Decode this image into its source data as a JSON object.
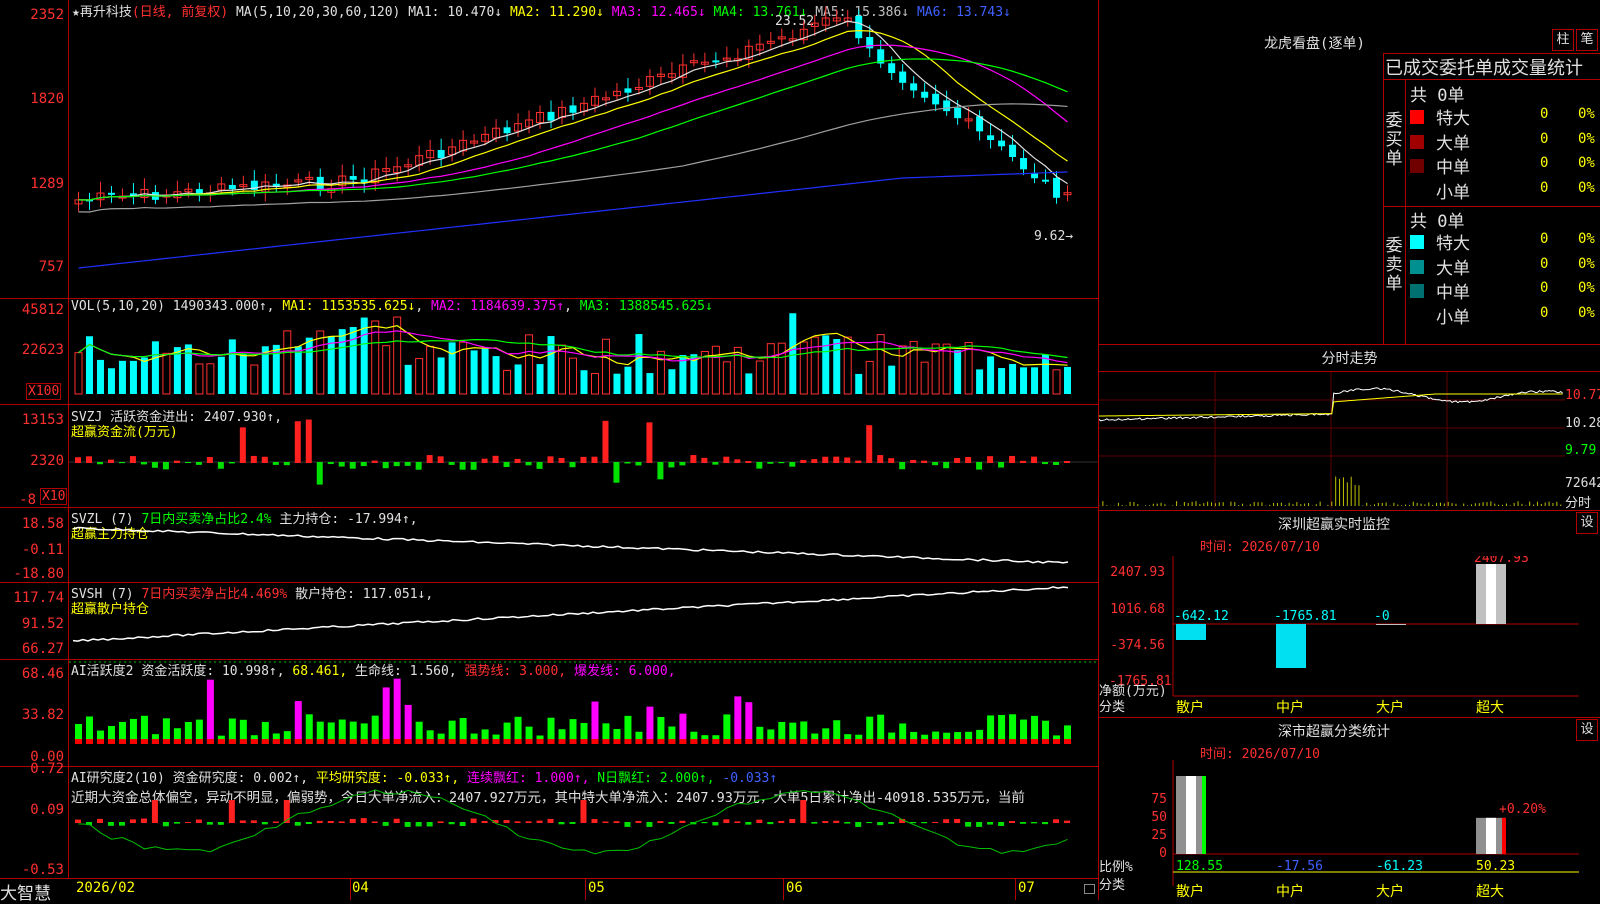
{
  "main": {
    "stock_name": "再升科技",
    "period": "(日线, 前复权)",
    "ma_params": "MA(5,10,20,30,60,120)",
    "ma_values": [
      {
        "label": "MA1: 10.470↓",
        "color": "#e0e0e0"
      },
      {
        "label": "MA2: 11.290↓",
        "color": "#ffff00"
      },
      {
        "label": "MA3: 12.465↓",
        "color": "#ff00ff"
      },
      {
        "label": "MA4: 13.761↓",
        "color": "#00ff00"
      },
      {
        "label": "MA5: 15.386↓",
        "color": "#c0c0c0"
      },
      {
        "label": "MA6: 13.743↓",
        "color": "#4060ff"
      }
    ],
    "y_ticks": [
      "2352",
      "1820",
      "1289",
      "757"
    ],
    "high_label": "23.52",
    "low_label": "9.62→"
  },
  "vol": {
    "title": "VOL(5,10,20)",
    "value": "1490343.000↑",
    "ma1": "MA1: 1153535.625↓",
    "ma2": "MA2: 1184639.375↑",
    "ma3": "MA3: 1388545.625↓",
    "y_ticks": [
      "45812",
      "22623"
    ],
    "unit": "X100"
  },
  "svzj": {
    "title": "SVZJ",
    "text": "活跃资金进出: 2407.930↑,",
    "subtitle": "超赢资金流(万元)",
    "y_ticks": [
      "13153",
      "2320",
      "-8"
    ],
    "unit": "X10"
  },
  "svzl": {
    "title": "SVZL (7)",
    "text1": "7日内买卖净占比2.4%",
    "text2": "主力持仓: -17.994↑,",
    "subtitle": "超赢主力持仓",
    "y_ticks": [
      "18.58",
      "-0.11",
      "-18.80"
    ]
  },
  "svsh": {
    "title": "SVSH (7)",
    "text1": "7日内买卖净占比4.469%",
    "text2": "散户持仓: 117.051↓,",
    "subtitle": "超赢散户持仓",
    "y_ticks": [
      "117.74",
      "91.52",
      "66.27"
    ]
  },
  "ai1": {
    "title": "AI活跃度2",
    "text1": "资金活跃度: 10.998↑,",
    "text2": "68.461,",
    "text3": "生命线: 1.560,",
    "text4": "强势线: 3.000,",
    "text5": "爆发线: 6.000,",
    "y_ticks": [
      "68.46",
      "33.82",
      "0.00"
    ]
  },
  "ai2": {
    "title": "AI研究度2(10)",
    "text1": "资金研究度: 0.002↑,",
    "text2": "平均研究度: -0.033↑,",
    "text3": "连续飘红: 1.000↑,",
    "text4": "N日飘红: 2.000↑,",
    "text5": "-0.033↑",
    "comment": "近期大资金总体偏空，异动不明显，偏弱势，今日大单净流入：2407.927万元，其中特大单净流入：2407.93万元，大单5日累计净出-40918.535万元，当前",
    "y_ticks": [
      "0.72",
      "0.09",
      "-0.53"
    ]
  },
  "xaxis": [
    "2026/02",
    "04",
    "05",
    "06",
    "07"
  ],
  "brand": "大智慧",
  "right": {
    "dragon_title": "龙虎看盘(逐单)",
    "btn_zhu": "柱",
    "btn_bi": "笔",
    "ob_header": "已成交委托单成交量统计",
    "buy_label": "委买单",
    "sell_label": "委卖单",
    "buy_total": "共 0单",
    "sell_total": "共 0单",
    "buy_rows": [
      {
        "name": "特大",
        "v": "0",
        "p": "0%",
        "color": "#ff0000"
      },
      {
        "name": "大单",
        "v": "0",
        "p": "0%",
        "color": "#a00000"
      },
      {
        "name": "中单",
        "v": "0",
        "p": "0%",
        "color": "#700000"
      },
      {
        "name": "小单",
        "v": "0",
        "p": "0%",
        "color": "#000000"
      }
    ],
    "sell_rows": [
      {
        "name": "特大",
        "v": "0",
        "p": "0%",
        "color": "#00ffff"
      },
      {
        "name": "大单",
        "v": "0",
        "p": "0%",
        "color": "#009090"
      },
      {
        "name": "中单",
        "v": "0",
        "p": "0%",
        "color": "#007070"
      },
      {
        "name": "小单",
        "v": "0",
        "p": "0%",
        "color": "#000000"
      }
    ],
    "intraday_title": "分时走势",
    "intraday_ticks": [
      "10.77",
      "10.28",
      "9.79",
      "72642",
      "分时"
    ],
    "monitor_title": "深圳超赢实时监控",
    "set_label": "设",
    "monitor_time": "时间: 2026/07/10",
    "monitor_ticks": [
      "2407.93",
      "1016.68",
      "-374.56",
      "-1765.81"
    ],
    "monitor_values": [
      {
        "cat": "散户",
        "v": "-642.12",
        "num": -642.12
      },
      {
        "cat": "中户",
        "v": "-1765.81",
        "num": -1765.81
      },
      {
        "cat": "大户",
        "v": "-0",
        "num": 0
      },
      {
        "cat": "超大",
        "v": "2407.93",
        "num": 2407.93
      }
    ],
    "monitor_ylabel": "净额(万元)",
    "monitor_xlabel": "分类",
    "class_title": "深市超赢分类统计",
    "class_time": "时间: 2026/07/10",
    "class_ticks": [
      "75",
      "50",
      "25",
      "0"
    ],
    "class_values": [
      {
        "cat": "散户",
        "v": "128.55",
        "num": 128.55
      },
      {
        "cat": "中户",
        "v": "-17.56",
        "num": -17.56
      },
      {
        "cat": "大户",
        "v": "-61.23",
        "num": -61.23
      },
      {
        "cat": "超大",
        "v": "50.23",
        "num": 50.23
      }
    ],
    "class_annot": "+0.20%",
    "class_ylabel": "比例%",
    "class_xlabel": "分类"
  }
}
